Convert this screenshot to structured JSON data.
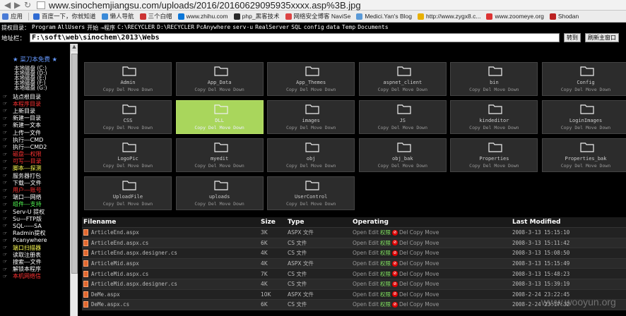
{
  "browser": {
    "url": "www.sinochemjiangsu.com/uploads/2016/20160629095935xxxx.asp%3B.jpg",
    "bookmarks": [
      "应用",
      "百度一下，你就知道",
      "懒人导航",
      "三个白帽",
      "www.zhihu.com",
      "php_黑客技术",
      "网络安全博客 NaviSe",
      "Medici.Yan's Blog",
      "http://www.zygx8.c...",
      "www.zoomeye.org",
      "Shodan"
    ]
  },
  "toolbar": {
    "quick_links": [
      "提权目录：",
      "Program",
      "AllUsers",
      "开始",
      "→程序",
      "C:\\RECYCLER",
      "D:\\RECYCLER",
      "PcAnywhere",
      "serv-u",
      "RealServer",
      "SQL",
      "config",
      "data",
      "Temp",
      "Documents"
    ],
    "address_label": "地址栏：",
    "path_value": "F:\\soft\\web\\sinochem\\2013\\Webs",
    "go_label": "转到",
    "refresh_label": "刷新主窗口"
  },
  "sidebar": {
    "title": "★ 菜刀本免费 ★",
    "drives": [
      "本地磁盘 (C:)",
      "本地磁盘 (D:)",
      "本地磁盘 (E:)",
      "本地磁盘 (F:)",
      "本地磁盘 (G:)"
    ],
    "items": [
      {
        "label": "站点根目录",
        "color": "#ffffff"
      },
      {
        "label": "本程序目录",
        "color": "#ff3333"
      },
      {
        "label": "上新目录",
        "color": "#ffffff"
      },
      {
        "label": "新建一目录",
        "color": "#ffffff"
      },
      {
        "label": "新建一文本",
        "color": "#ffffff"
      },
      {
        "label": "上传一文件",
        "color": "#ffffff"
      },
      {
        "label": "执行---CMD",
        "color": "#ffffff"
      },
      {
        "label": "执行---CMD2",
        "color": "#ffffff"
      },
      {
        "label": "磁盘---权限",
        "color": "#ff3333"
      },
      {
        "label": "可写---目录",
        "color": "#ff3333"
      },
      {
        "label": "脚本---探测",
        "color": "#ffff55"
      },
      {
        "label": "服务器打包",
        "color": "#ffffff"
      },
      {
        "label": "下载---文件",
        "color": "#ffffff"
      },
      {
        "label": "用户---账号",
        "color": "#ff3333"
      },
      {
        "label": "端口---网络",
        "color": "#ffffff"
      },
      {
        "label": "组件---支持",
        "color": "#55ff55"
      },
      {
        "label": "Serv-U 提权",
        "color": "#ffffff"
      },
      {
        "label": "Su---FTP版",
        "color": "#ffffff"
      },
      {
        "label": "SQL-----SA",
        "color": "#ffffff"
      },
      {
        "label": "Radmin提权",
        "color": "#ffffff"
      },
      {
        "label": "Pcanywhere",
        "color": "#ffffff"
      },
      {
        "label": "端口扫描器",
        "color": "#ffff55"
      },
      {
        "label": "读取注册表",
        "color": "#ffffff"
      },
      {
        "label": "搜索---文件",
        "color": "#ffffff"
      },
      {
        "label": "解锁本程序",
        "color": "#ffffff"
      },
      {
        "label": "本机网络信",
        "color": "#ff3333"
      }
    ]
  },
  "folders": [
    {
      "name": "Admin",
      "selected": false
    },
    {
      "name": "App_Data",
      "selected": false
    },
    {
      "name": "App_Themes",
      "selected": false
    },
    {
      "name": "aspnet_client",
      "selected": false
    },
    {
      "name": "bin",
      "selected": false
    },
    {
      "name": "Config",
      "selected": false
    },
    {
      "name": "CSS",
      "selected": false
    },
    {
      "name": "DLL",
      "selected": true
    },
    {
      "name": "images",
      "selected": false
    },
    {
      "name": "JS",
      "selected": false
    },
    {
      "name": "kindeditor",
      "selected": false
    },
    {
      "name": "LoginImages",
      "selected": false
    },
    {
      "name": "LogoPic",
      "selected": false
    },
    {
      "name": "myedit",
      "selected": false
    },
    {
      "name": "obj",
      "selected": false
    },
    {
      "name": "obj_bak",
      "selected": false
    },
    {
      "name": "Properties",
      "selected": false
    },
    {
      "name": "Properties_bak",
      "selected": false
    },
    {
      "name": "UploadFile",
      "selected": false
    },
    {
      "name": "uploads",
      "selected": false
    },
    {
      "name": "UserControl",
      "selected": false
    }
  ],
  "folder_actions": "Copy Del Move Down",
  "table": {
    "headers": [
      "Filename",
      "Size",
      "Type",
      "Operating",
      "Last Modified"
    ],
    "ops": {
      "a": "Open Edit",
      "perm": "权限",
      "b": "Del Copy Move"
    },
    "rows": [
      {
        "name": "ArticleEnd.aspx",
        "size": "3K",
        "type": "ASPX 文件",
        "date": "2008-3-13 15:15:10"
      },
      {
        "name": "ArticleEnd.aspx.cs",
        "size": "6K",
        "type": "CS 文件",
        "date": "2008-3-13 15:11:42"
      },
      {
        "name": "ArticleEnd.aspx.designer.cs",
        "size": "4K",
        "type": "CS 文件",
        "date": "2008-3-13 15:08:50"
      },
      {
        "name": "ArticleMid.aspx",
        "size": "4K",
        "type": "ASPX 文件",
        "date": "2008-3-13 15:15:49"
      },
      {
        "name": "ArticleMid.aspx.cs",
        "size": "7K",
        "type": "CS 文件",
        "date": "2008-3-13 15:48:23"
      },
      {
        "name": "ArticleMid.aspx.designer.cs",
        "size": "4K",
        "type": "CS 文件",
        "date": "2008-3-13 15:39:19"
      },
      {
        "name": "DeMe.aspx",
        "size": "10K",
        "type": "ASPX 文件",
        "date": "2008-2-24 23:22:45"
      },
      {
        "name": "DeMe.aspx.cs",
        "size": "6K",
        "type": "CS 文件",
        "date": "2008-2-24 23:17:32"
      }
    ]
  },
  "watermark": "www.wooyun.org"
}
